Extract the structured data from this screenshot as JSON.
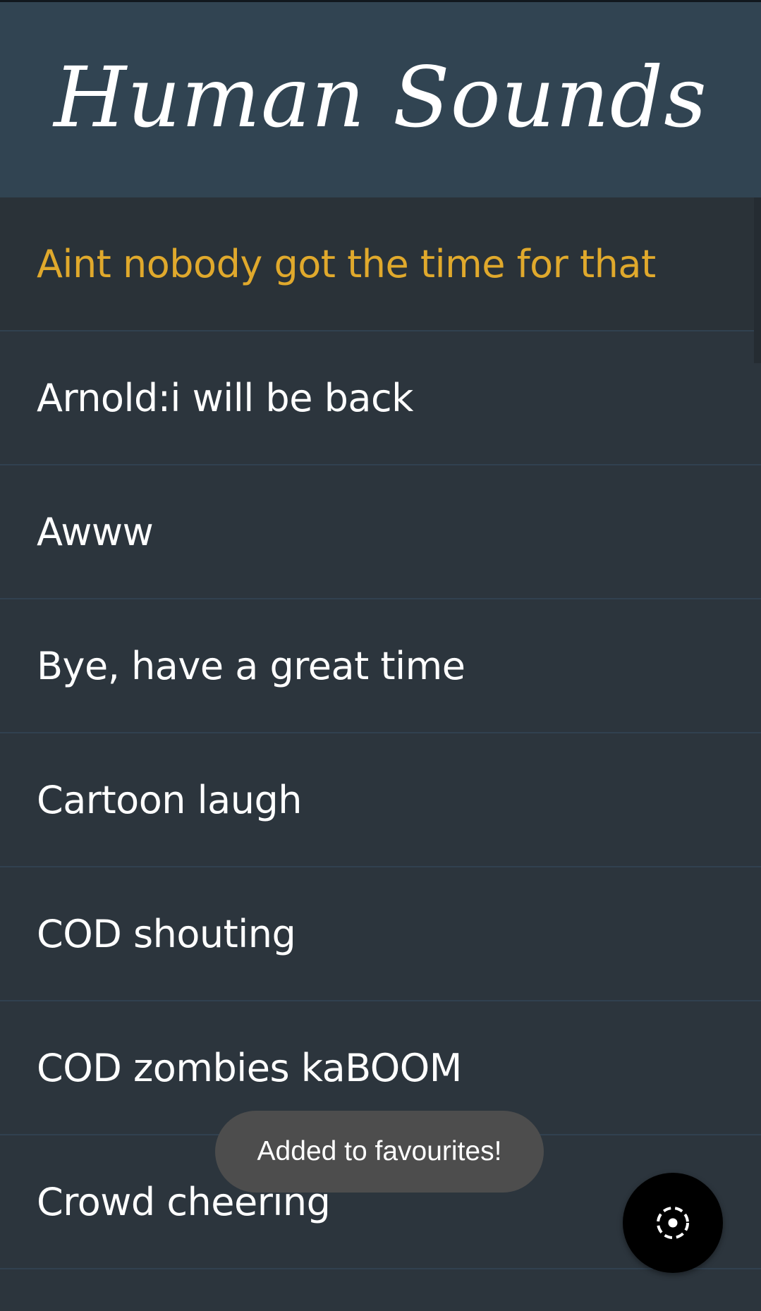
{
  "app": {
    "title": "Human Sounds"
  },
  "sounds": {
    "items": [
      {
        "label": "Aint nobody got the time for that",
        "selected": true
      },
      {
        "label": "Arnold:i will be back",
        "selected": false
      },
      {
        "label": "Awww",
        "selected": false
      },
      {
        "label": "Bye, have a great time",
        "selected": false
      },
      {
        "label": "Cartoon laugh",
        "selected": false
      },
      {
        "label": "COD shouting",
        "selected": false
      },
      {
        "label": "COD zombies kaBOOM",
        "selected": false
      },
      {
        "label": "Crowd cheering",
        "selected": false
      }
    ]
  },
  "toast": {
    "message": "Added to favourites!"
  },
  "fab": {
    "icon": "dashed-circle-dot-icon"
  },
  "colors": {
    "header_bg": "#314452",
    "list_bg": "#2c353d",
    "selected_text": "#e0a92c",
    "text": "#ffffff",
    "toast_bg": "#4d4d4d"
  }
}
